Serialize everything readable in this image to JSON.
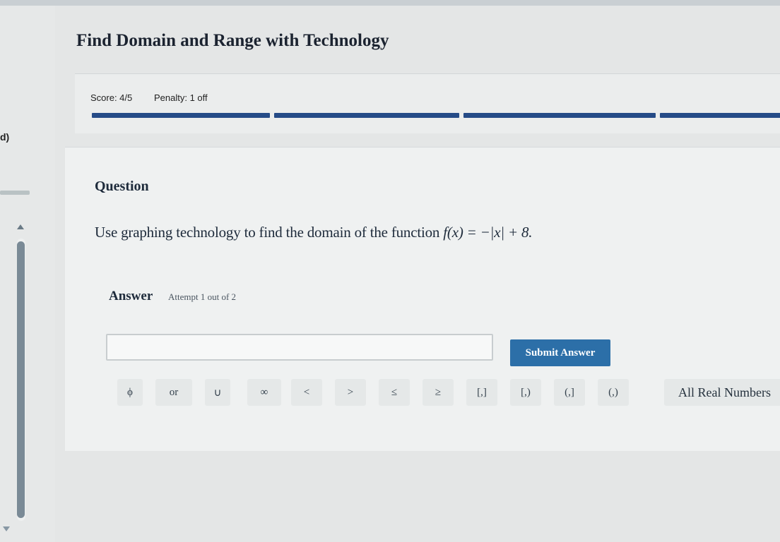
{
  "side_label": "d)",
  "page": {
    "title": "Find Domain and Range with Technology"
  },
  "score": {
    "score_text": "Score: 4/5",
    "penalty_text": "Penalty: 1 off",
    "progress_completed": 4,
    "progress_total": 5
  },
  "question": {
    "heading": "Question",
    "text": "Use graphing technology to find the domain of the function ",
    "math": "f(x) = −|x| + 8."
  },
  "answer": {
    "label": "Answer",
    "attempt": "Attempt 1 out of 2",
    "input_value": "",
    "submit_label": "Submit Answer"
  },
  "symbols": [
    "ϕ",
    "or",
    "∪",
    "∞",
    "<",
    ">",
    "≤",
    "≥",
    "[,]",
    "[,)",
    "(,]",
    "(,)",
    "All Real Numbers"
  ],
  "colors": {
    "accent": "#2c6fa8",
    "progress": "#254b87",
    "background": "#e4e6e6"
  },
  "icons": {
    "cursor": "mouse-pointer-icon"
  }
}
